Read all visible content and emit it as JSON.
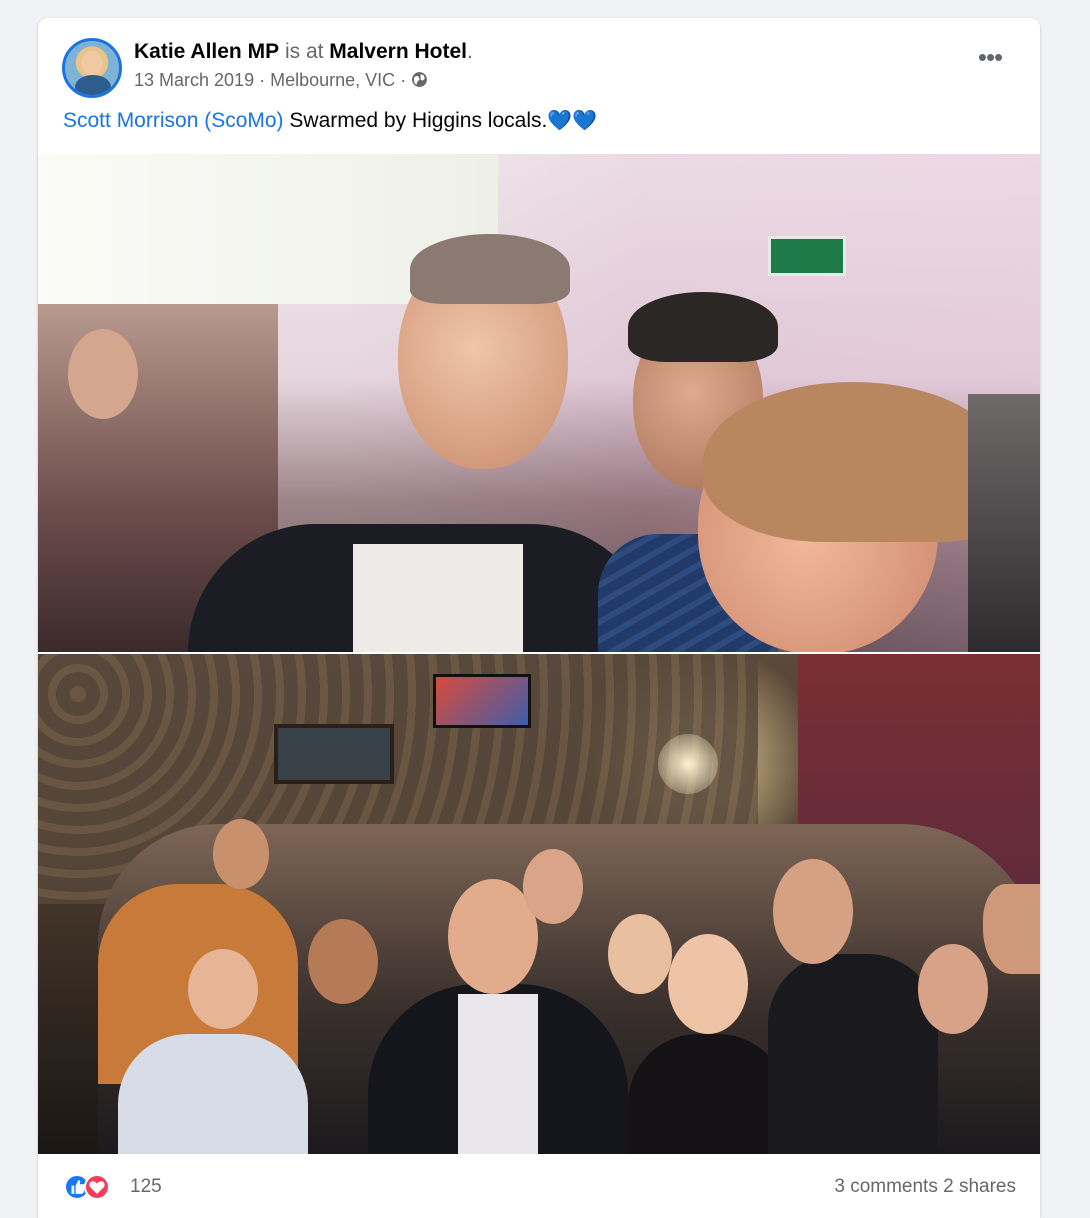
{
  "post": {
    "author": "Katie Allen MP",
    "checkin_connector": "is at",
    "location_name": "Malvern Hotel",
    "title_end": ".",
    "date": "13 March 2019",
    "city": "Melbourne, VIC",
    "meta_sep": "·",
    "privacy_icon": "globe-icon",
    "more_label": "•••",
    "caption": {
      "mention": "Scott Morrison (ScoMo)",
      "text": " Swarmed by Higgins locals.",
      "emoji": "💙💙"
    },
    "reactions": {
      "icons": [
        "like-icon",
        "love-icon"
      ],
      "count": "125"
    },
    "engagement": "3 comments  2 shares"
  },
  "colors": {
    "link": "#1b74e4",
    "muted": "#65676b",
    "like": "#1877f2",
    "love": "#f33e58"
  }
}
